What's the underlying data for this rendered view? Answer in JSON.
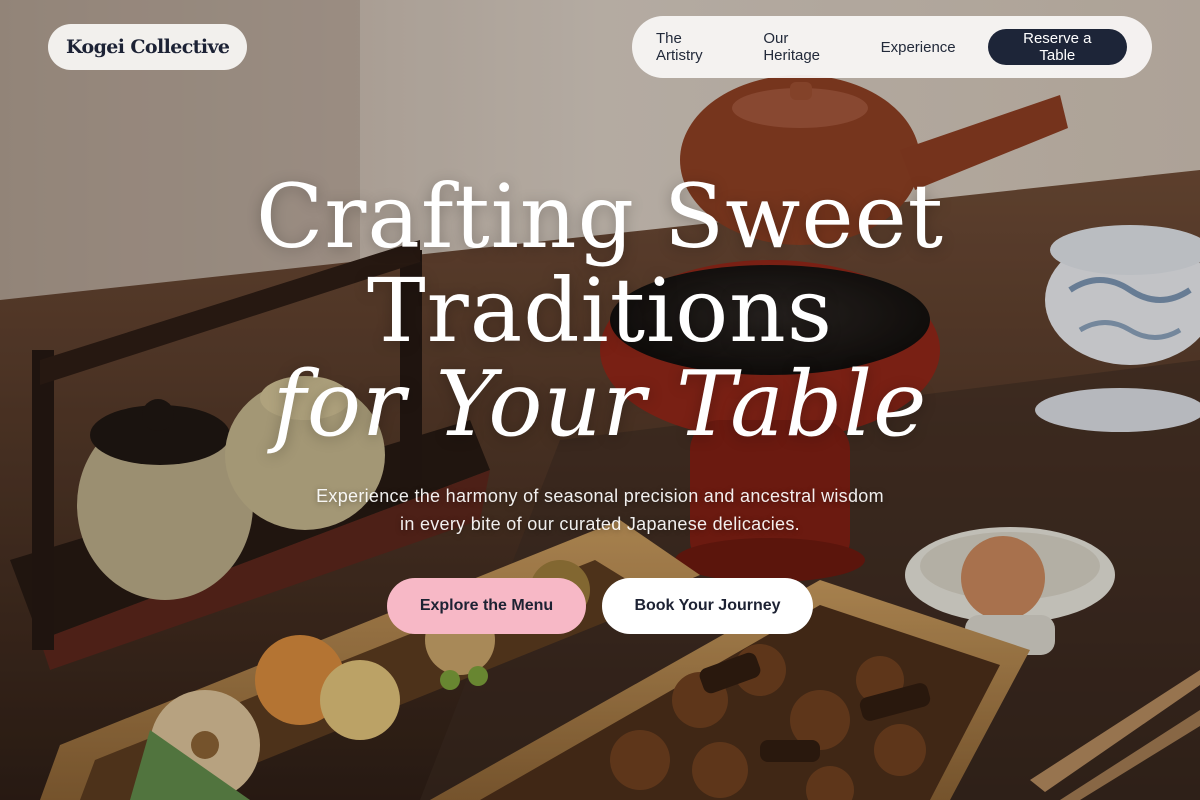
{
  "brand": {
    "name": "Kogei Collective"
  },
  "nav": {
    "links": [
      "The Artistry",
      "Our Heritage",
      "Experience"
    ],
    "cta_label": "Reserve a Table"
  },
  "hero": {
    "title_line_1": "Crafting Sweet",
    "title_line_2": "Traditions",
    "title_line_3": "for Your Table",
    "subtitle_line_1": "Experience the harmony of seasonal precision and ancestral wisdom",
    "subtitle_line_2": "in every bite of our curated Japanese delicacies.",
    "primary_cta": "Explore the Menu",
    "secondary_cta": "Book Your Journey"
  },
  "colors": {
    "brand_navy": "#1d2538",
    "accent_pink": "#f7b8c6",
    "pill_background": "#f8f6f4"
  }
}
